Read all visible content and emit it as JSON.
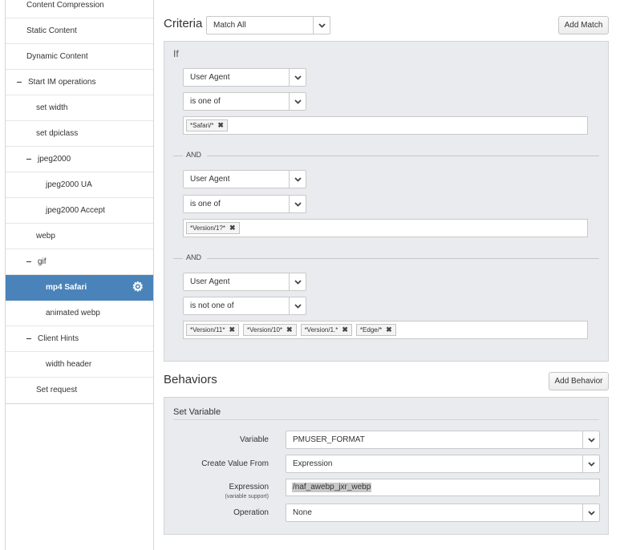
{
  "sidebar": {
    "items": [
      {
        "label": "Content Compression"
      },
      {
        "label": "Static Content"
      },
      {
        "label": "Dynamic Content"
      },
      {
        "label": "Start IM operations"
      },
      {
        "label": "set width"
      },
      {
        "label": "set dpiclass"
      },
      {
        "label": "jpeg2000"
      },
      {
        "label": "jpeg2000 UA"
      },
      {
        "label": "jpeg2000 Accept"
      },
      {
        "label": "webp"
      },
      {
        "label": "gif"
      },
      {
        "label": "mp4 Safari"
      },
      {
        "label": "animated webp"
      },
      {
        "label": "Client Hints"
      },
      {
        "label": "width header"
      },
      {
        "label": "Set request"
      }
    ],
    "selected_color": "#4a83b9"
  },
  "criteria": {
    "title": "Criteria",
    "match_select": "Match All",
    "add_match_label": "Add Match",
    "if_label": "If",
    "and_label": "AND",
    "conditions": [
      {
        "field": "User Agent",
        "operator": "is one of",
        "values": [
          "*Safari/*"
        ]
      },
      {
        "field": "User Agent",
        "operator": "is one of",
        "values": [
          "*Version/1?*"
        ]
      },
      {
        "field": "User Agent",
        "operator": "is not one of",
        "values": [
          "*Version/11*",
          "*Version/10*",
          "*Version/1.*",
          "*Edge/*"
        ]
      }
    ]
  },
  "behaviors": {
    "title": "Behaviors",
    "add_behavior_label": "Add Behavior",
    "set_variable": {
      "title": "Set Variable",
      "variable_label": "Variable",
      "variable_value": "PMUSER_FORMAT",
      "create_from_label": "Create Value From",
      "create_from_value": "Expression",
      "expression_label": "Expression",
      "expression_sub": "(variable support)",
      "expression_value": "/naf_awebp_jxr_webp",
      "operation_label": "Operation",
      "operation_value": "None"
    }
  },
  "icons": {
    "gear": "gear-icon",
    "chevron": "chevron-down-icon",
    "remove": "close-icon",
    "collapse": "minus-icon"
  }
}
